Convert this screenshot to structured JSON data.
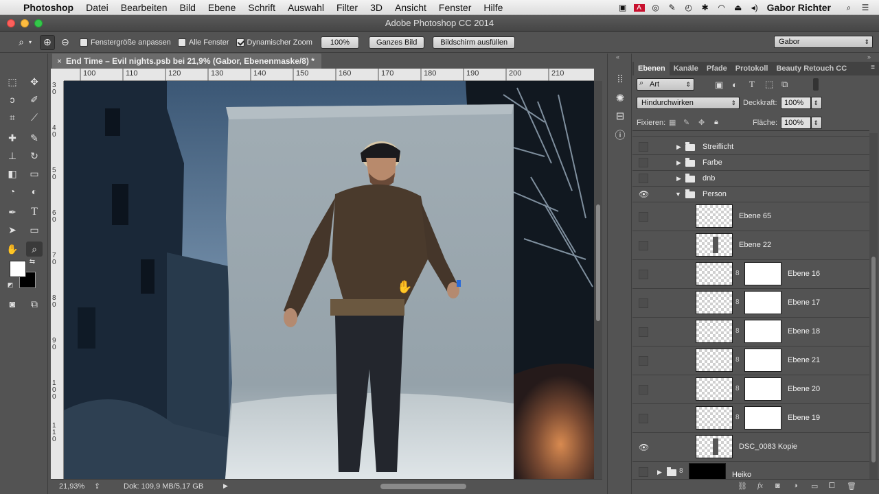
{
  "menubar": {
    "app_name": "Photoshop",
    "items": [
      "Datei",
      "Bearbeiten",
      "Bild",
      "Ebene",
      "Schrift",
      "Auswahl",
      "Filter",
      "3D",
      "Ansicht",
      "Fenster",
      "Hilfe"
    ],
    "user": "Gabor Richter"
  },
  "window": {
    "title": "Adobe Photoshop CC 2014"
  },
  "options": {
    "fit_window_label": "Fenstergröße anpassen",
    "all_windows_label": "Alle Fenster",
    "dynamic_zoom_label": "Dynamischer Zoom",
    "zoom_value": "100%",
    "whole_image_btn": "Ganzes Bild",
    "fill_screen_btn": "Bildschirm ausfüllen",
    "workspace": "Gabor"
  },
  "document": {
    "tab_title": "End Time – Evil nights.psb bei 21,9% (Gabor, Ebenenmaske/8) *",
    "ruler_h": [
      "100",
      "110",
      "120",
      "130",
      "140",
      "150",
      "160",
      "170",
      "180",
      "190",
      "200",
      "210"
    ],
    "ruler_v": [
      "3\n0",
      "4\n0",
      "5\n0",
      "6\n0",
      "7\n0",
      "8\n0",
      "9\n0",
      "1\n0\n0",
      "1\n1\n0"
    ]
  },
  "status": {
    "zoom": "21,93%",
    "doc_info": "Dok: 109,9 MB/5,17 GB"
  },
  "panel": {
    "tabs": [
      "Ebenen",
      "Kanäle",
      "Pfade",
      "Protokoll",
      "Beauty Retouch CC"
    ],
    "filter_kind": "Art",
    "blend_mode": "Hindurchwirken",
    "opacity_label": "Deckkraft:",
    "opacity_value": "100%",
    "lock_label": "Fixieren:",
    "fill_label": "Fläche:",
    "fill_value": "100%"
  },
  "layers": {
    "groups": [
      {
        "name": "Streiflicht",
        "visible": false
      },
      {
        "name": "Farbe",
        "visible": false
      },
      {
        "name": "dnb",
        "visible": false
      },
      {
        "name": "Person",
        "visible": true
      }
    ],
    "items": [
      {
        "name": "Ebene 65",
        "visible": false,
        "mask": false
      },
      {
        "name": "Ebene 22",
        "visible": false,
        "mask": false
      },
      {
        "name": "Ebene 16",
        "visible": false,
        "mask": true
      },
      {
        "name": "Ebene 17",
        "visible": false,
        "mask": true
      },
      {
        "name": "Ebene 18",
        "visible": false,
        "mask": true
      },
      {
        "name": "Ebene 21",
        "visible": false,
        "mask": true
      },
      {
        "name": "Ebene 20",
        "visible": false,
        "mask": true
      },
      {
        "name": "Ebene 19",
        "visible": false,
        "mask": true
      },
      {
        "name": "DSC_0083 Kopie",
        "visible": true,
        "mask": false
      }
    ],
    "bottom_group": "Heiko"
  },
  "colors": {
    "foreground": "#ffffff",
    "background": "#000000",
    "chrome": "#535353"
  }
}
